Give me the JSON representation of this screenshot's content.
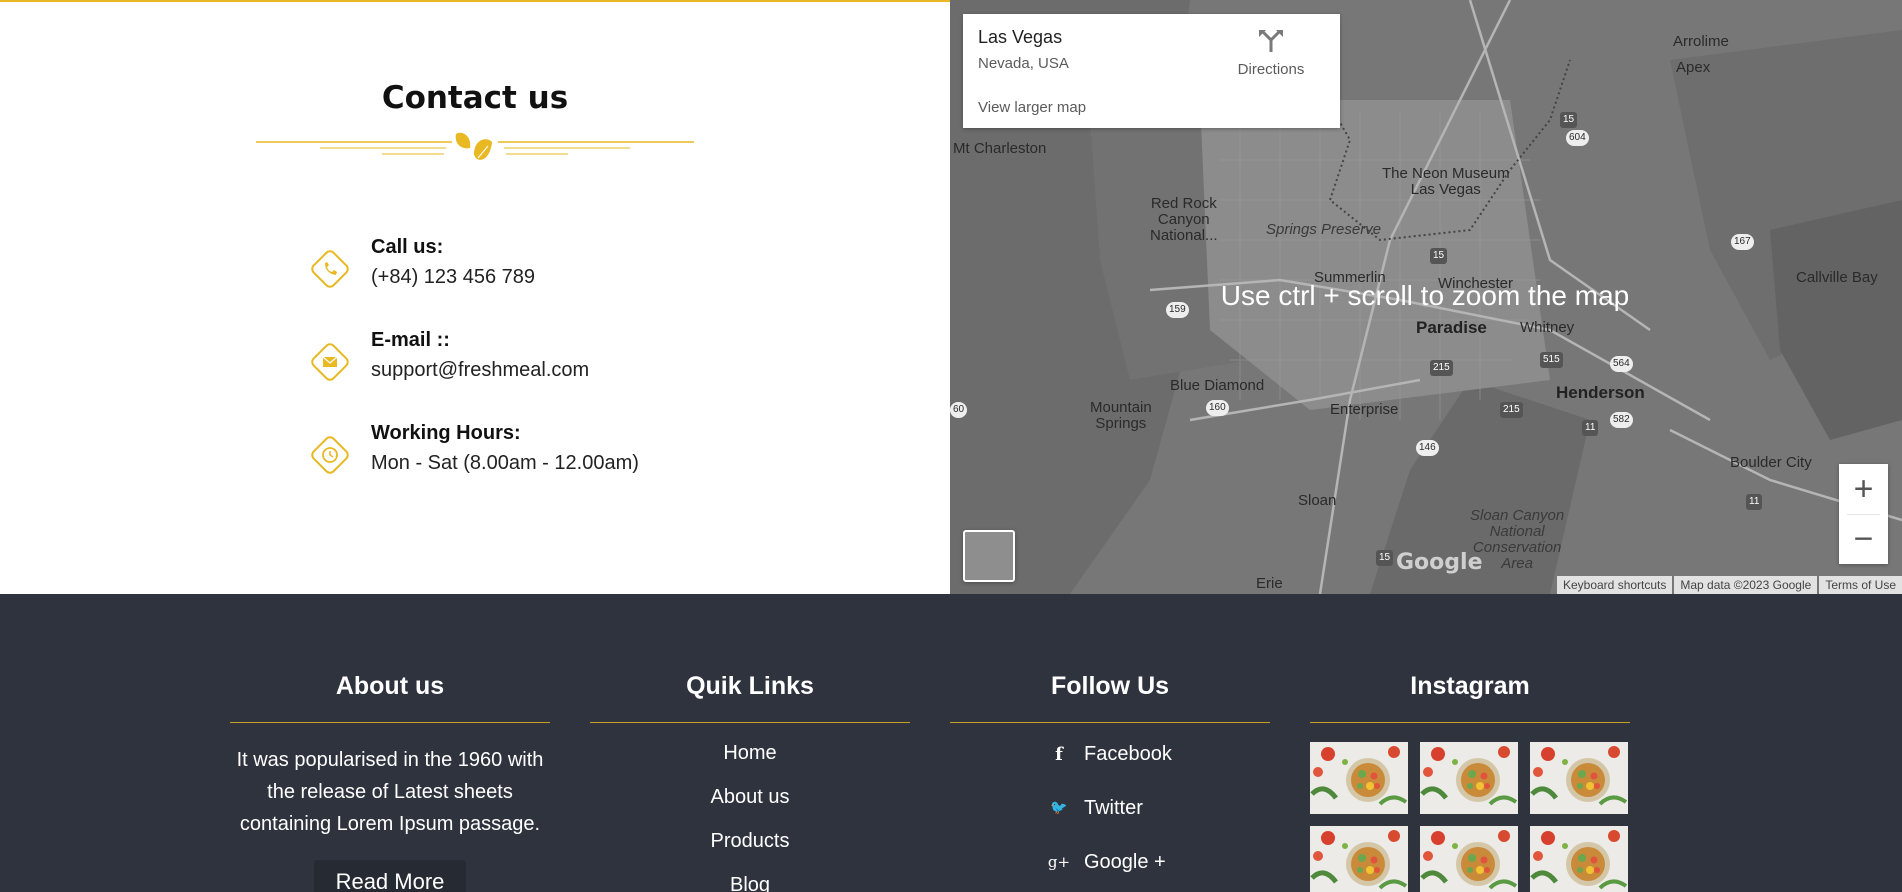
{
  "contact": {
    "title": "Contact us",
    "items": [
      {
        "icon": "phone-icon",
        "label": "Call us:",
        "value": "(+84) 123 456 789"
      },
      {
        "icon": "envelope-icon",
        "label": "E-mail ::",
        "value": "support@freshmeal.com"
      },
      {
        "icon": "clock-icon",
        "label": "Working Hours:",
        "value": "Mon - Sat (8.00am - 12.00am)"
      }
    ]
  },
  "map": {
    "place_name": "Las Vegas",
    "place_address": "Nevada, USA",
    "directions_label": "Directions",
    "view_larger": "View larger map",
    "zoom_hint": "Use ctrl + scroll to zoom the map",
    "zoom_in": "+",
    "zoom_out": "−",
    "google_logo": "Google",
    "attribution": {
      "keyboard": "Keyboard shortcuts",
      "data": "Map data ©2023 Google",
      "terms": "Terms of Use"
    },
    "labels": {
      "mt_charleston": "Mt Charleston",
      "red_rock": "Red Rock\nCanyon\nNational...",
      "neon_museum": "The Neon Museum\nLas Vegas",
      "springs_preserve": "Springs Preserve",
      "summerlin": "Summerlin",
      "winchester": "Winchester",
      "paradise": "Paradise",
      "whitney": "Whitney",
      "blue_diamond": "Blue Diamond",
      "enterprise": "Enterprise",
      "mountain_springs": "Mountain\nSprings",
      "henderson": "Henderson",
      "sloan": "Sloan",
      "sloan_canyon": "Sloan Canyon\nNational\nConservation\nArea",
      "erie": "Erie",
      "arrolime": "Arrolime",
      "apex": "Apex",
      "callville_bay": "Callville Bay",
      "boulder_city": "Boulder City",
      "rt_15a": "15",
      "rt_604": "604",
      "rt_167": "167",
      "rt_15b": "15",
      "rt_159": "159",
      "rt_215a": "215",
      "rt_515": "515",
      "rt_564": "564",
      "rt_160a": "160",
      "rt_60": "60",
      "rt_215b": "215",
      "rt_11a": "11",
      "rt_582": "582",
      "rt_146": "146",
      "rt_11b": "11",
      "rt_15c": "15"
    }
  },
  "footer": {
    "about": {
      "heading": "About us",
      "text": "It was popularised in the 1960 with the release of Latest sheets containing Lorem Ipsum passage.",
      "button": "Read More"
    },
    "links": {
      "heading": "Quik Links",
      "items": [
        "Home",
        "About us",
        "Products",
        "Blog"
      ]
    },
    "follow": {
      "heading": "Follow Us",
      "items": [
        {
          "icon": "facebook-icon",
          "glyph": "f",
          "label": "Facebook"
        },
        {
          "icon": "twitter-icon",
          "glyph": "🐦",
          "label": "Twitter"
        },
        {
          "icon": "google-plus-icon",
          "glyph": "g+",
          "label": "Google +"
        }
      ]
    },
    "instagram": {
      "heading": "Instagram"
    }
  },
  "colors": {
    "accent": "#e8b923",
    "footer_bg": "#2f333e",
    "map_bg": "#7a7a7a"
  }
}
